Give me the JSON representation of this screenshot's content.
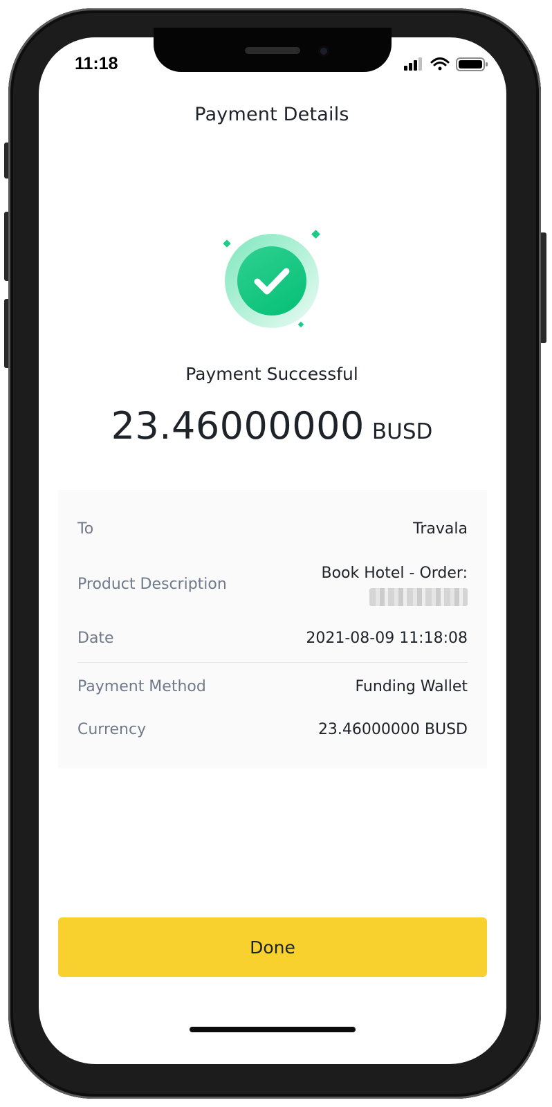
{
  "status_bar": {
    "time": "11:18",
    "icons": [
      "cellular-signal-icon",
      "wifi-icon",
      "battery-icon"
    ]
  },
  "header": {
    "title": "Payment Details"
  },
  "result": {
    "icon": "check-circle-icon",
    "title": "Payment Successful",
    "amount": "23.46000000",
    "unit": "BUSD"
  },
  "details": {
    "to_label": "To",
    "to_value": "Travala",
    "product_label": "Product Description",
    "product_value": "Book Hotel - Order:",
    "date_label": "Date",
    "date_value": "2021-08-09 11:18:08",
    "method_label": "Payment Method",
    "method_value": "Funding Wallet",
    "currency_label": "Currency",
    "currency_value": "23.46000000 BUSD"
  },
  "actions": {
    "done_label": "Done"
  },
  "colors": {
    "accent": "#F8D12F",
    "success": "#0ECB81",
    "text_primary": "#1E2329",
    "text_secondary": "#707A8A",
    "card_background": "#FAFAFA"
  }
}
